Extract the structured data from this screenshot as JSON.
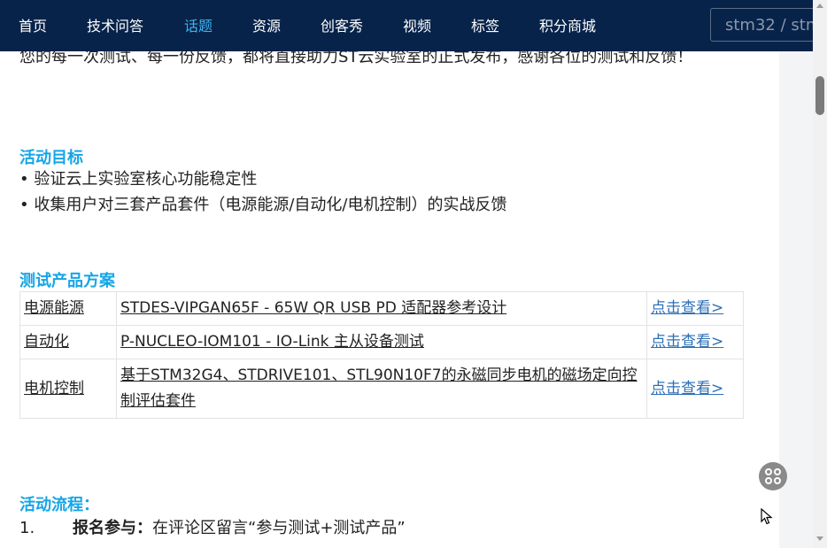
{
  "nav": {
    "items": [
      "首页",
      "技术问答",
      "话题",
      "资源",
      "创客秀",
      "视频",
      "标签",
      "积分商城"
    ],
    "active": "话题",
    "search_value": "stm32 / stm"
  },
  "intro": {
    "text": "您的每一次测试、每一份反馈，都将直接助力ST云实验室的正式发布，感谢各位的测试和反馈！"
  },
  "goals": {
    "heading": "活动目标",
    "bullets": [
      "• 验证云上实验室核心功能稳定性",
      "• 收集用户对三套产品套件（电源能源/自动化/电机控制）的实战反馈"
    ]
  },
  "products": {
    "heading": "测试产品方案",
    "rows": [
      {
        "category": "电源能源",
        "name": "STDES-VIPGAN65F - 65W QR USB PD 适配器参考设计",
        "link": "点击查看>"
      },
      {
        "category": "自动化",
        "name": "P-NUCLEO-IOM101 - IO-Link 主从设备测试",
        "link": "点击查看>"
      },
      {
        "category": "电机控制",
        "name": "基于STM32G4、STDRIVE101、STL90N10F7的永磁同步电机的磁场定向控制评估套件",
        "link": "点击查看>"
      }
    ]
  },
  "flow": {
    "heading": "活动流程：",
    "steps": [
      {
        "num": "1.",
        "title": "报名参与：",
        "text": "在评论区留言“参与测试+测试产品”"
      }
    ]
  },
  "colors": {
    "nav_bg": "#07234a",
    "nav_active": "#3db4f2",
    "heading": "#16a5e6",
    "link": "#2d6fb5"
  }
}
